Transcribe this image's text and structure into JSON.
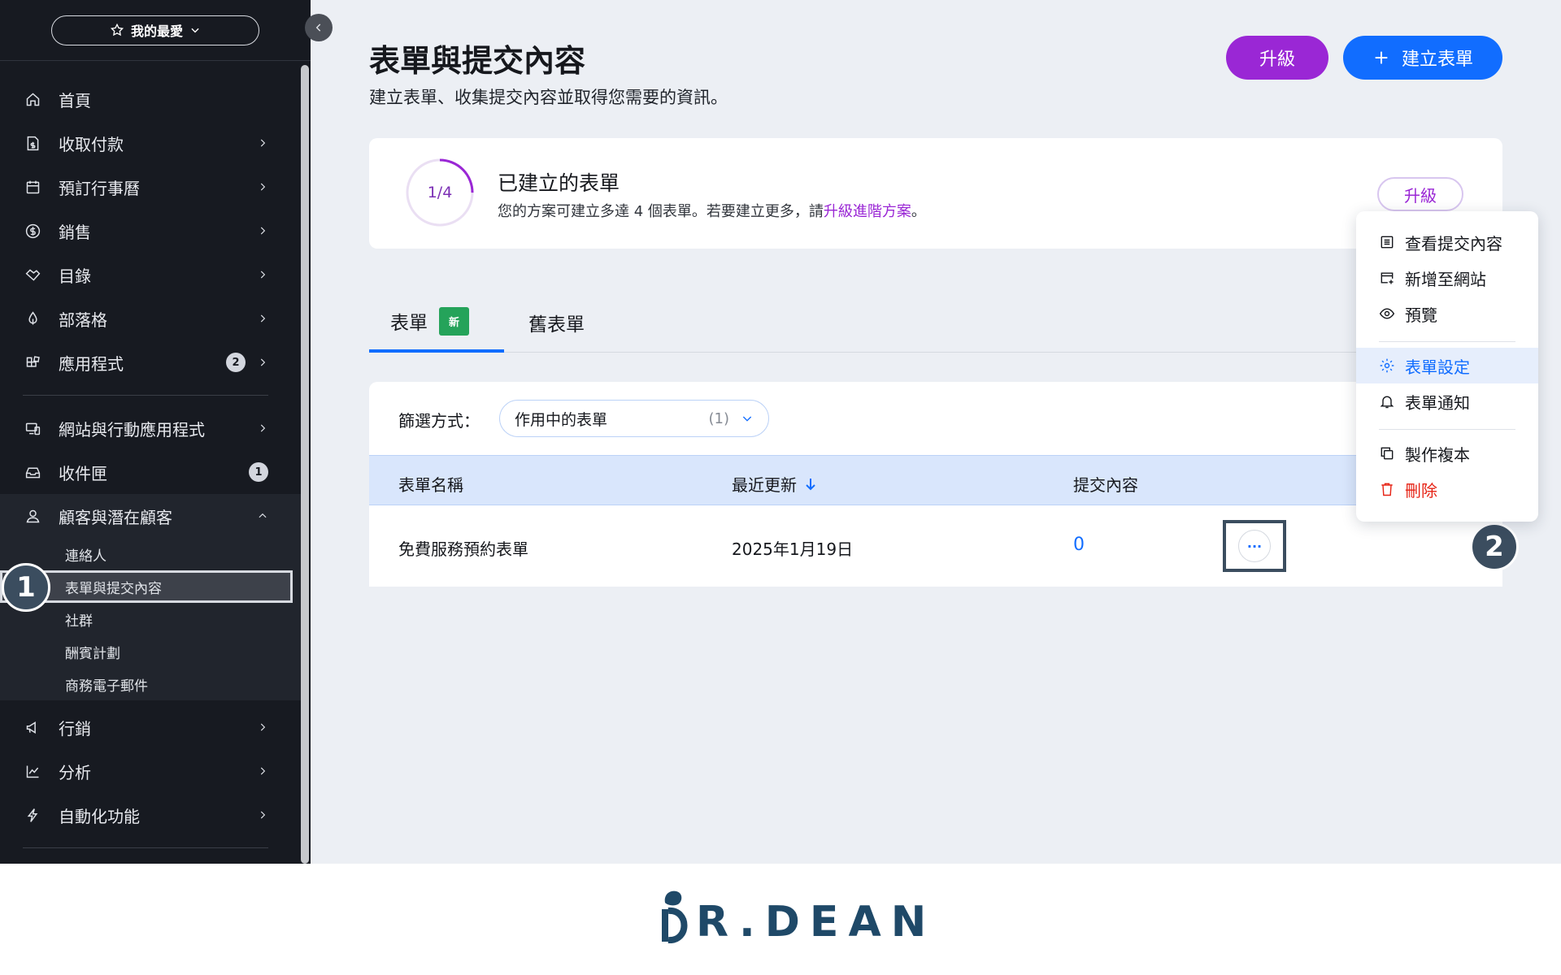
{
  "sidebar": {
    "favorites_label": "我的最愛",
    "nav": [
      {
        "label": "首頁",
        "icon": "home-icon"
      },
      {
        "label": "收取付款",
        "icon": "payment-icon"
      },
      {
        "label": "預訂行事曆",
        "icon": "calendar-icon"
      },
      {
        "label": "銷售",
        "icon": "dollar-icon"
      },
      {
        "label": "目錄",
        "icon": "catalog-icon"
      },
      {
        "label": "部落格",
        "icon": "pen-icon"
      },
      {
        "label": "應用程式",
        "icon": "apps-icon",
        "badge": "2"
      }
    ],
    "nav2": [
      {
        "label": "網站與行動應用程式",
        "icon": "devices-icon"
      },
      {
        "label": "收件匣",
        "icon": "inbox-icon",
        "badge": "1"
      },
      {
        "label": "顧客與潛在顧客",
        "icon": "contacts-icon"
      }
    ],
    "sub": [
      "連絡人",
      "表單與提交內容",
      "社群",
      "酬賓計劃",
      "商務電子郵件"
    ],
    "nav3": [
      {
        "label": "行銷",
        "icon": "megaphone-icon"
      },
      {
        "label": "分析",
        "icon": "chart-icon"
      },
      {
        "label": "自動化功能",
        "icon": "lightning-icon"
      }
    ]
  },
  "markers": {
    "one": "1",
    "two": "2"
  },
  "header": {
    "title": "表單與提交內容",
    "subtitle": "建立表單、收集提交內容並取得您需要的資訊。",
    "upgrade_label": "升級",
    "create_label": "建立表單"
  },
  "quota": {
    "progress_label": "1/4",
    "progress_fraction": 0.25,
    "title": "已建立的表單",
    "text_before": "您的方案可建立多達 4 個表單。若要建立更多，請",
    "link": "升級進階方案",
    "text_after": "。",
    "upgrade_label": "升級"
  },
  "tabs": {
    "forms": "表單",
    "new_badge": "新",
    "old_forms": "舊表單"
  },
  "filter": {
    "label": "篩選方式：",
    "value": "作用中的表單",
    "count": "(1)"
  },
  "table": {
    "columns": [
      "表單名稱",
      "最近更新",
      "提交內容"
    ],
    "rows": [
      {
        "name": "免費服務預約表單",
        "updated": "2025年1月19日",
        "submissions": "0"
      }
    ],
    "more_label": "···"
  },
  "menu": {
    "items": [
      "查看提交內容",
      "新增至網站",
      "預覽",
      "表單設定",
      "表單通知",
      "製作複本",
      "刪除"
    ]
  },
  "footer": {
    "logo_text": "R.DEAN"
  },
  "colors": {
    "accent": "#116dff",
    "upgrade": "#9a27d5",
    "sidebar": "#171a21",
    "danger": "#e62214",
    "marker": "#3b4d5f"
  }
}
